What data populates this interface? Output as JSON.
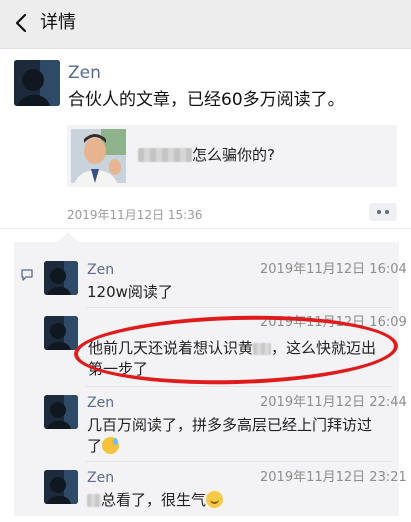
{
  "nav": {
    "back_icon": "chevron-left-icon",
    "title": "详情"
  },
  "post": {
    "author": "Zen",
    "text": "合伙人的文章，已经60多万阅读了。",
    "link": {
      "title_visible": "怎么骗你的?"
    },
    "time": "2019年11月12日 15:36",
    "more_icon": "more-dots-icon"
  },
  "comments": [
    {
      "name": "Zen",
      "time": "2019年11月12日 16:04",
      "text": "120w阅读了"
    },
    {
      "name": "Zen",
      "time": "2019年11月12日 16:09",
      "text_line1_a": "他前几天还说着想认识黄",
      "text_line1_b": "，这么快就迈出",
      "text_line2": "第一步了"
    },
    {
      "name": "Zen",
      "time": "2019年11月12日 22:44",
      "text_line1": "几百万阅读了，拼多多高层已经上门拜访过",
      "text_line2": "了"
    },
    {
      "name": "Zen",
      "time": "2019年11月12日 23:21",
      "text": "总看了，很生气"
    }
  ],
  "colors": {
    "link_blue": "#576b95",
    "annotation_red": "#e01b1b",
    "panel_bg": "#f3f3f5"
  }
}
